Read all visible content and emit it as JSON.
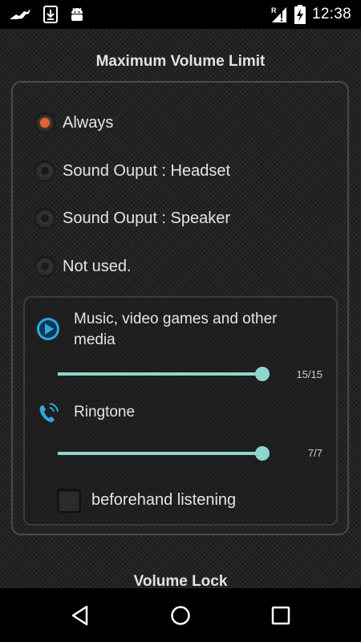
{
  "status_bar": {
    "time": "12:38",
    "left_icons": [
      "notification-bird-icon",
      "download-icon",
      "android-icon"
    ],
    "right_icons": [
      "roaming-signal-icon",
      "battery-charging-icon"
    ]
  },
  "section_title": "Maximum Volume Limit",
  "radio_options": [
    {
      "label": "Always",
      "checked": true
    },
    {
      "label": "Sound Ouput : Headset",
      "checked": false
    },
    {
      "label": "Sound Ouput : Speaker",
      "checked": false
    },
    {
      "label": "Not used.",
      "checked": false
    }
  ],
  "media": {
    "label": "Music, video games and other media",
    "value_text": "15/15",
    "value": 15,
    "max": 15
  },
  "ringtone": {
    "label": "Ringtone",
    "value_text": "7/7",
    "value": 7,
    "max": 7
  },
  "checkbox": {
    "label": "beforehand listening",
    "checked": false
  },
  "next_section_title": "Volume Lock",
  "colors": {
    "accent_orange": "#e8632d",
    "slider_teal": "#8fd6cc",
    "icon_blue": "#2ea8e0"
  },
  "nav": {
    "buttons": [
      "back-icon",
      "home-icon",
      "recents-icon"
    ]
  }
}
